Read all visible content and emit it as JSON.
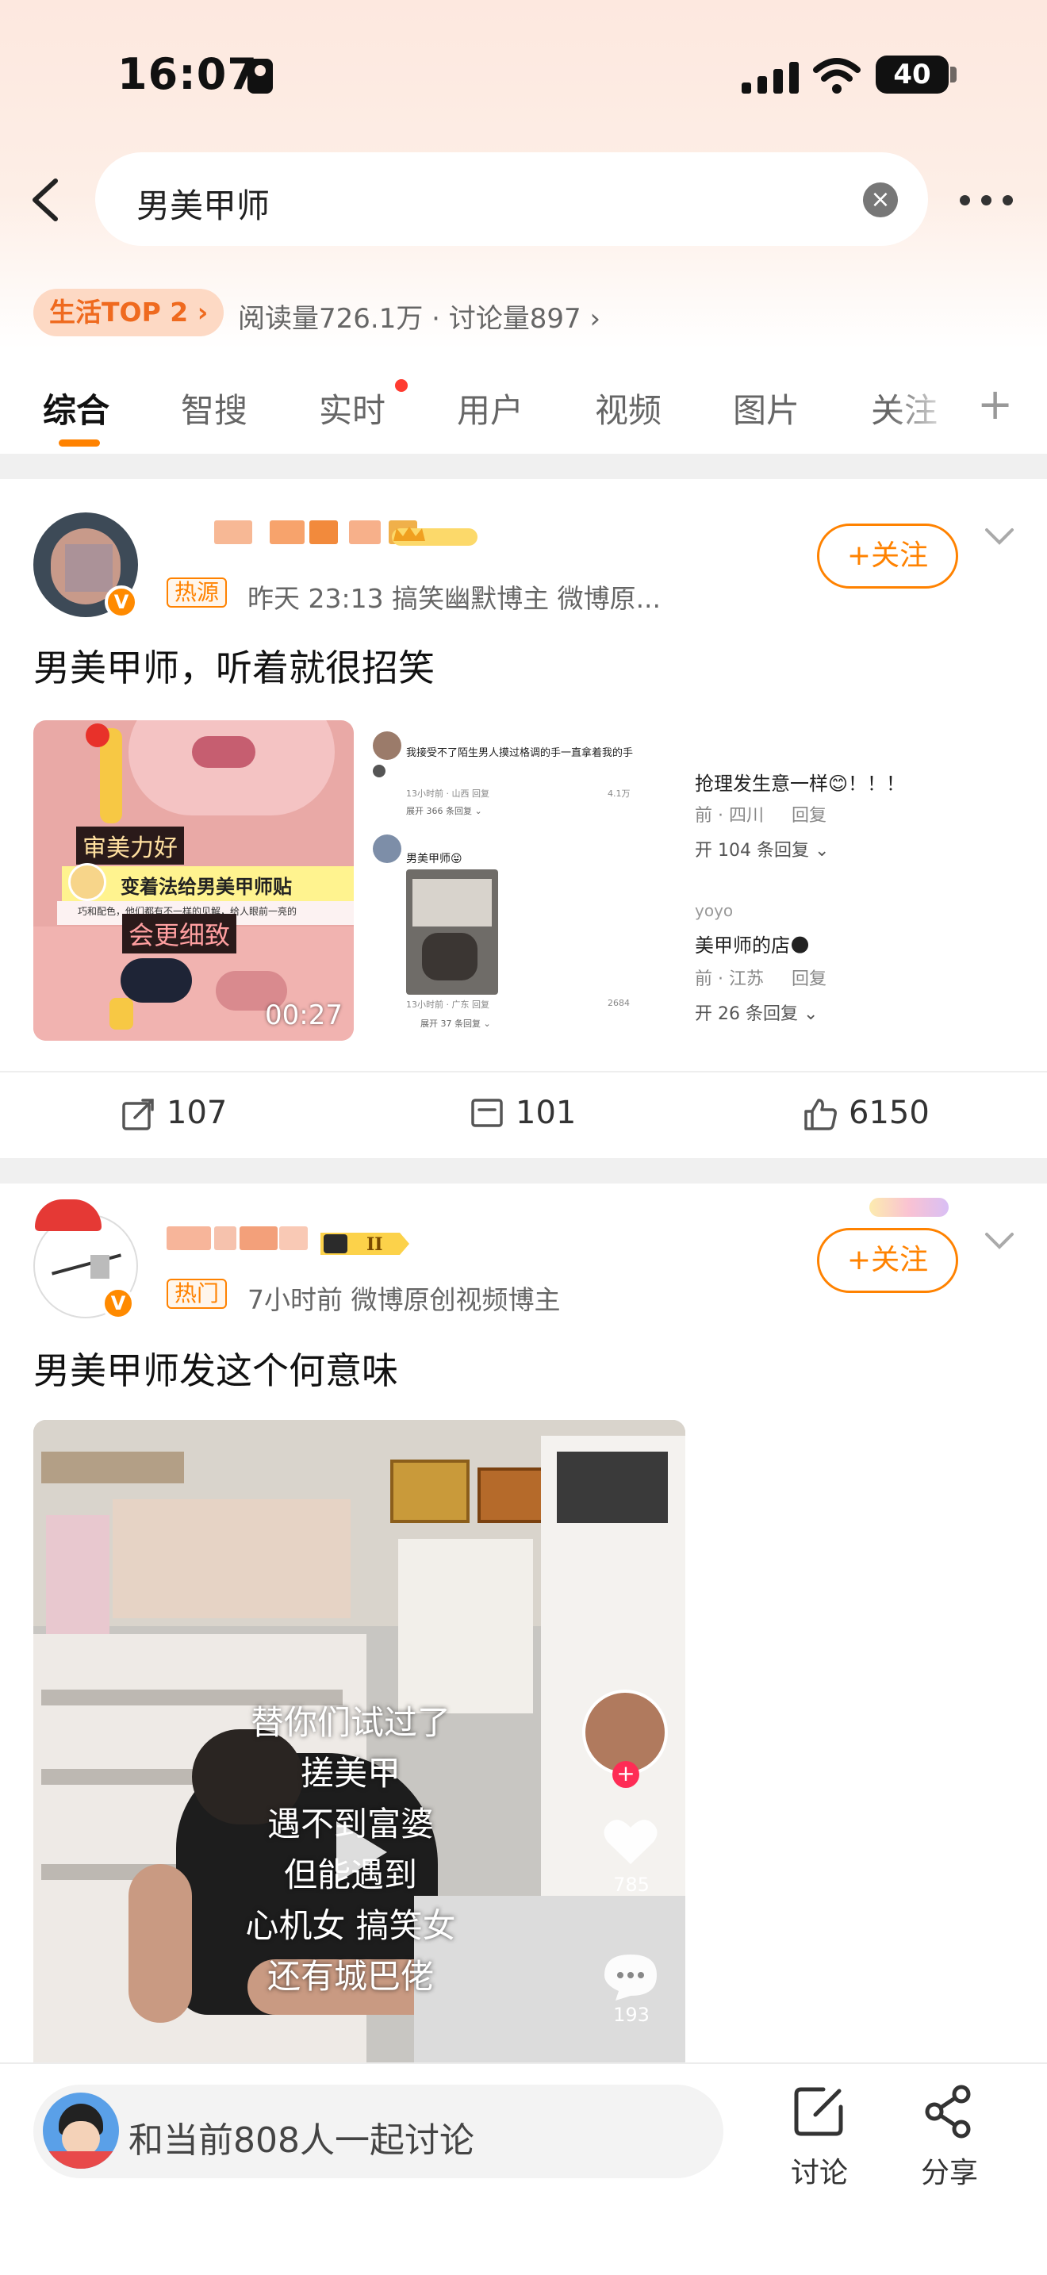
{
  "status_bar": {
    "time": "16:07",
    "battery": "40"
  },
  "search": {
    "query": "男美甲师"
  },
  "topic": {
    "rank_badge": "生活TOP 2 ›",
    "stats": "阅读量726.1万 · 讨论量897 ›"
  },
  "tabs": [
    {
      "label": "综合",
      "active": true
    },
    {
      "label": "智搜"
    },
    {
      "label": "实时",
      "has_dot": true
    },
    {
      "label": "用户"
    },
    {
      "label": "视频"
    },
    {
      "label": "图片"
    },
    {
      "label": "关注"
    }
  ],
  "posts": [
    {
      "tag": "热源",
      "meta": "昨天 23:13  搞笑幽默博主 微博原...",
      "follow_label": "+关注",
      "text": "男美甲师，听着就很招笑",
      "images": {
        "video_duration": "00:27",
        "video_captions": [
          "审美力好",
          "变着法给男美甲师贴",
          "巧和配色，他们都有不一样的见解，给人眼前一亮的",
          "会更细致"
        ],
        "screenshot_2": {
          "comment_1": "我接受不了陌生男人摸过格调的手一直拿着我的手",
          "comment_1_meta": "13小时前 · 山西   回复",
          "comment_1_likes": "4.1万",
          "comment_1_replies": "展开 366 条回复 ⌄",
          "comment_2": "男美甲师😝",
          "comment_2_meta": "13小时前 · 广东   回复",
          "comment_2_likes": "2684",
          "comment_2_replies": "展开 37 条回复 ⌄"
        },
        "screenshot_3": {
          "line_1": "抢理发生意一样😊！！！",
          "line_1_meta": "前 · 四川     回复",
          "line_1_replies": "开 104 条回复 ⌄",
          "user_2": "yoyo",
          "line_2": "美甲师的店🌑",
          "line_2_meta": "前 · 江苏     回复",
          "line_2_replies": "开 26 条回复 ⌄"
        }
      },
      "actions": {
        "repost": "107",
        "comment": "101",
        "like": "6150"
      }
    },
    {
      "tag": "热门",
      "meta": "7小时前  微博原创视频博主",
      "follow_label": "+关注",
      "text": "男美甲师发这个何意味",
      "video_caption_lines": [
        "替你们试过了",
        "搓美甲",
        "遇不到富婆",
        "但能遇到",
        "心机女 搞笑女",
        "还有城巴佬"
      ],
      "video_side": {
        "likes": "785",
        "comments": "193"
      }
    }
  ],
  "bottom": {
    "discuss_text": "和当前808人一起讨论",
    "discuss_label": "讨论",
    "share_label": "分享"
  },
  "colors": {
    "accent": "#ff8200",
    "tab_dot": "#ff3b30"
  }
}
